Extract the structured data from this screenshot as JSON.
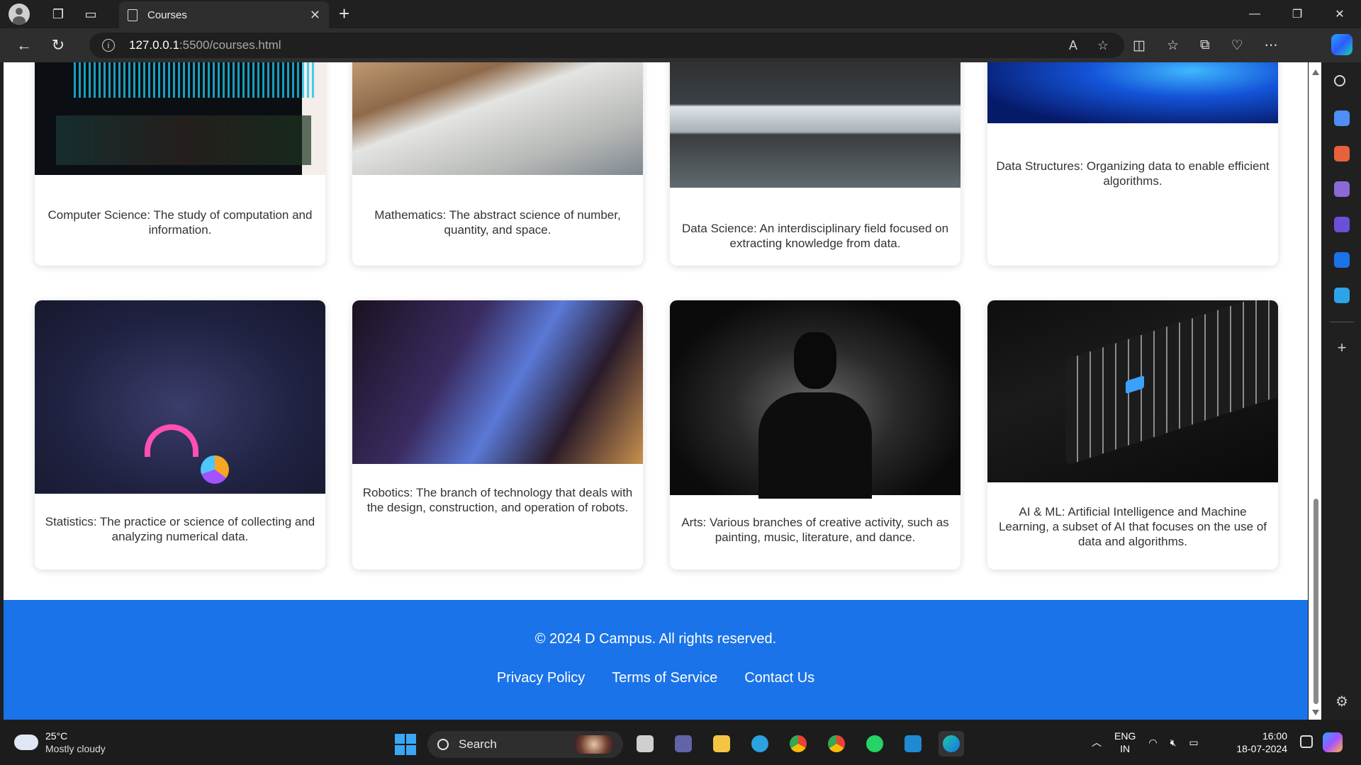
{
  "browser": {
    "tab_title": "Courses",
    "url_host": "127.0.0.1",
    "url_path": ":5500/courses.html"
  },
  "courses": [
    {
      "icon": "computer-science-dashboard-image",
      "description": "Computer Science: The study of computation and information."
    },
    {
      "icon": "mathematics-sketch-image",
      "description": "Mathematics: The abstract science of number, quantity, and space."
    },
    {
      "icon": "data-science-laptop-image",
      "description": "Data Science: An interdisciplinary field focused on extracting knowledge from data."
    },
    {
      "icon": "data-structures-network-image",
      "description": "Data Structures: Organizing data to enable efficient algorithms."
    },
    {
      "icon": "statistics-charts-image",
      "description": "Statistics: The practice or science of collecting and analyzing numerical data."
    },
    {
      "icon": "robotics-desk-image",
      "description": "Robotics: The branch of technology that deals with the design, construction, and operation of robots."
    },
    {
      "icon": "arts-silhouette-image",
      "description": "Arts: Various branches of creative activity, such as painting, music, literature, and dance."
    },
    {
      "icon": "ai-ml-keyboard-image",
      "description": "AI & ML: Artificial Intelligence and Machine Learning, a subset of AI that focuses on the use of data and algorithms."
    }
  ],
  "footer": {
    "copyright": "© 2024 D Campus. All rights reserved.",
    "links": [
      "Privacy Policy",
      "Terms of Service",
      "Contact Us"
    ],
    "background_color": "#1a73e8"
  },
  "taskbar": {
    "weather_temp": "25°C",
    "weather_desc": "Mostly cloudy",
    "search_label": "Search",
    "lang_1": "ENG",
    "lang_2": "IN",
    "time": "16:00",
    "date": "18-07-2024"
  }
}
